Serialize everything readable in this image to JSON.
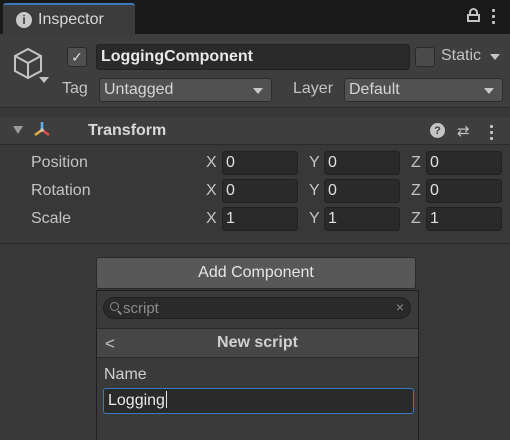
{
  "tab": {
    "label": "Inspector",
    "icon": "info-icon"
  },
  "tab_actions": {
    "lock_icon": "lock-icon",
    "menu_icon": "kebab-menu-icon"
  },
  "object": {
    "active": true,
    "name": "LoggingComponent",
    "static_checked": false,
    "static_label": "Static",
    "tag_label": "Tag",
    "tag_value": "Untagged",
    "layer_label": "Layer",
    "layer_value": "Default"
  },
  "transform": {
    "title": "Transform",
    "expanded": true,
    "rows": [
      {
        "label": "Position",
        "x": "0",
        "y": "0",
        "z": "0"
      },
      {
        "label": "Rotation",
        "x": "0",
        "y": "0",
        "z": "0"
      },
      {
        "label": "Scale",
        "x": "1",
        "y": "1",
        "z": "1"
      }
    ],
    "axes": {
      "x": "X",
      "y": "Y",
      "z": "Z"
    }
  },
  "add_component": {
    "button_label": "Add Component",
    "search_text": "script",
    "clear_glyph": "×",
    "back_glyph": "<",
    "panel_title": "New script",
    "name_label": "Name",
    "name_value": "Logging"
  },
  "colors": {
    "accent": "#3a79bb",
    "panel_bg": "#383838",
    "header_bg": "#3e3e3e",
    "tab_bar_bg": "#191919",
    "field_bg": "#2a2a2a"
  }
}
